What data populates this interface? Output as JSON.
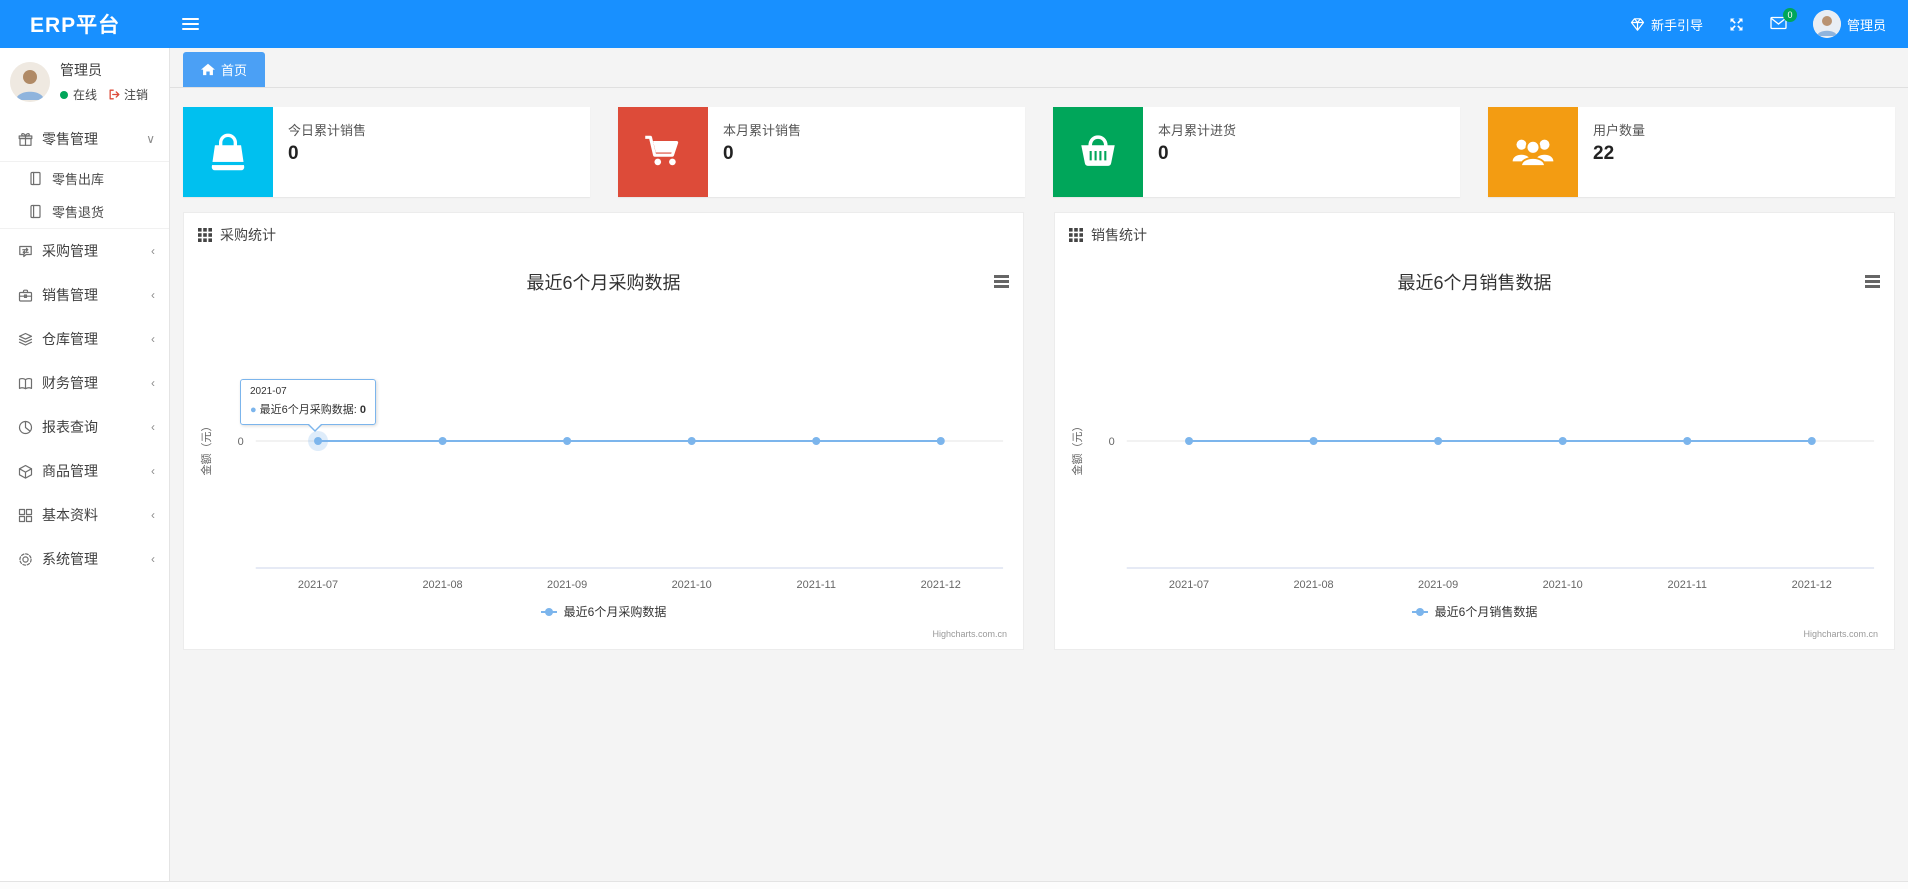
{
  "navbar": {
    "brand": "ERP平台",
    "guide_label": "新手引导",
    "mail_badge": "0",
    "username": "管理员"
  },
  "sidebar": {
    "username": "管理员",
    "status_label": "在线",
    "logout_label": "注销",
    "menus": [
      {
        "label": "零售管理",
        "icon": "gift-icon",
        "state": "expanded",
        "children": [
          {
            "label": "零售出库",
            "icon": "notebook-icon"
          },
          {
            "label": "零售退货",
            "icon": "notebook-icon"
          }
        ]
      },
      {
        "label": "采购管理",
        "icon": "chat-loop-icon",
        "state": "collapsed"
      },
      {
        "label": "销售管理",
        "icon": "briefcase-icon",
        "state": "collapsed"
      },
      {
        "label": "仓库管理",
        "icon": "layers-icon",
        "state": "collapsed"
      },
      {
        "label": "财务管理",
        "icon": "open-book-icon",
        "state": "collapsed"
      },
      {
        "label": "报表查询",
        "icon": "pie-chart-icon",
        "state": "collapsed"
      },
      {
        "label": "商品管理",
        "icon": "box-3d-icon",
        "state": "collapsed"
      },
      {
        "label": "基本资料",
        "icon": "grid-icon",
        "state": "collapsed"
      },
      {
        "label": "系统管理",
        "icon": "gear-icon",
        "state": "collapsed"
      }
    ],
    "chevron_expanded": "∨",
    "chevron_collapsed": "‹"
  },
  "tabs": [
    {
      "label": "首页",
      "icon": "home-icon",
      "active": true
    }
  ],
  "stat_cards": [
    {
      "label": "今日累计销售",
      "value": "0",
      "color": "#00c0ef",
      "icon": "shopping-bag-icon"
    },
    {
      "label": "本月累计销售",
      "value": "0",
      "color": "#dd4b39",
      "icon": "cart-icon"
    },
    {
      "label": "本月累计进货",
      "value": "0",
      "color": "#00a65a",
      "icon": "basket-icon"
    },
    {
      "label": "用户数量",
      "value": "22",
      "color": "#f39c12",
      "icon": "users-icon"
    }
  ],
  "panels": [
    {
      "title": "采购统计"
    },
    {
      "title": "销售统计"
    }
  ],
  "chart_data": [
    {
      "type": "line",
      "title": "最近6个月采购数据",
      "categories": [
        "2021-07",
        "2021-08",
        "2021-09",
        "2021-10",
        "2021-11",
        "2021-12"
      ],
      "series": [
        {
          "name": "最近6个月采购数据",
          "values": [
            0,
            0,
            0,
            0,
            0,
            0
          ]
        }
      ],
      "ylabel": "金额（元）",
      "yticks": [
        0
      ],
      "grid": true,
      "legend_position": "bottom",
      "line_color": "#7cb5ec",
      "credits": "Highcharts.com.cn",
      "tooltip": {
        "category": "2021-07",
        "label": "最近6个月采购数据:",
        "value": "0"
      }
    },
    {
      "type": "line",
      "title": "最近6个月销售数据",
      "categories": [
        "2021-07",
        "2021-08",
        "2021-09",
        "2021-10",
        "2021-11",
        "2021-12"
      ],
      "series": [
        {
          "name": "最近6个月销售数据",
          "values": [
            0,
            0,
            0,
            0,
            0,
            0
          ]
        }
      ],
      "ylabel": "金额（元）",
      "yticks": [
        0
      ],
      "grid": true,
      "legend_position": "bottom",
      "line_color": "#7cb5ec",
      "credits": "Highcharts.com.cn"
    }
  ]
}
